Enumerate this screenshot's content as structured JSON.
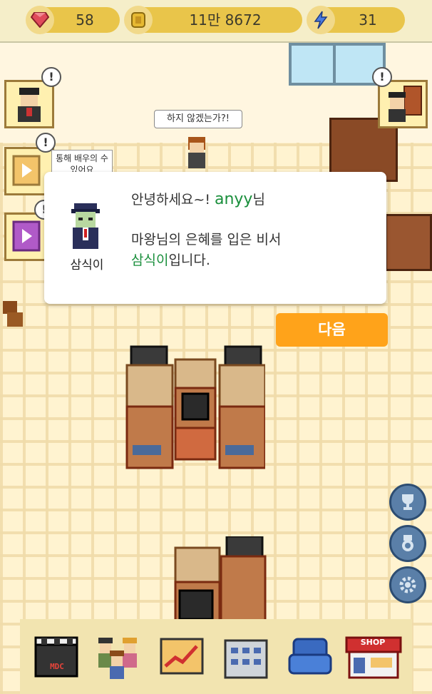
{
  "resources": {
    "gems": "58",
    "gold": "11만 8672",
    "energy": "31"
  },
  "scene": {
    "bubble": "하지 않겠는가?!",
    "note": "통해 배우의 수 있어요",
    "alert_mark": "!"
  },
  "dialog": {
    "speaker": "삼식이",
    "greeting": "안녕하세요~! ",
    "username": "anyy",
    "honorific": "님",
    "line2": "마왕님의 은혜를 입은 비서",
    "name_highlight": "삼식이",
    "line3_rest": "입니다."
  },
  "next_button": {
    "label": "다음"
  },
  "bottom_menu": {
    "items": [
      "video-clapper",
      "staff",
      "stats-chart",
      "building",
      "sofa",
      "shop"
    ],
    "mdc_label": "MDC",
    "shop_label": "SHOP"
  },
  "colors": {
    "accent": "#ffa31a",
    "highlight": "#1a8f3c",
    "pill": "#e9c54a"
  }
}
